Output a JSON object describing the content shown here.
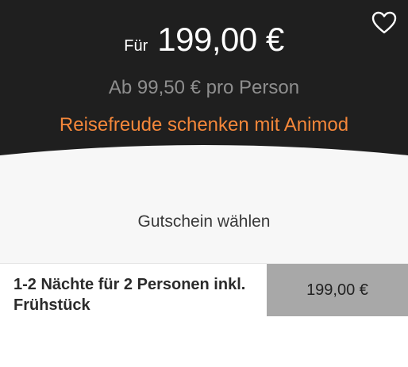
{
  "header": {
    "price_prefix": "Für",
    "price": "199,00 €",
    "per_person": "Ab 99,50 € pro Person",
    "gift_link": "Reisefreude schenken mit Animod",
    "favorite_icon": "heart-outline-icon"
  },
  "voucher": {
    "title": "Gutschein wählen",
    "options": [
      {
        "label": "1-2 Nächte für 2 Personen inkl. Frühstück",
        "price": "199,00 €"
      }
    ]
  },
  "colors": {
    "hero_background": "#1f1f1f",
    "accent": "#f4873a",
    "muted_text": "#8e8e8e",
    "price_cell": "#a8a8a8"
  }
}
